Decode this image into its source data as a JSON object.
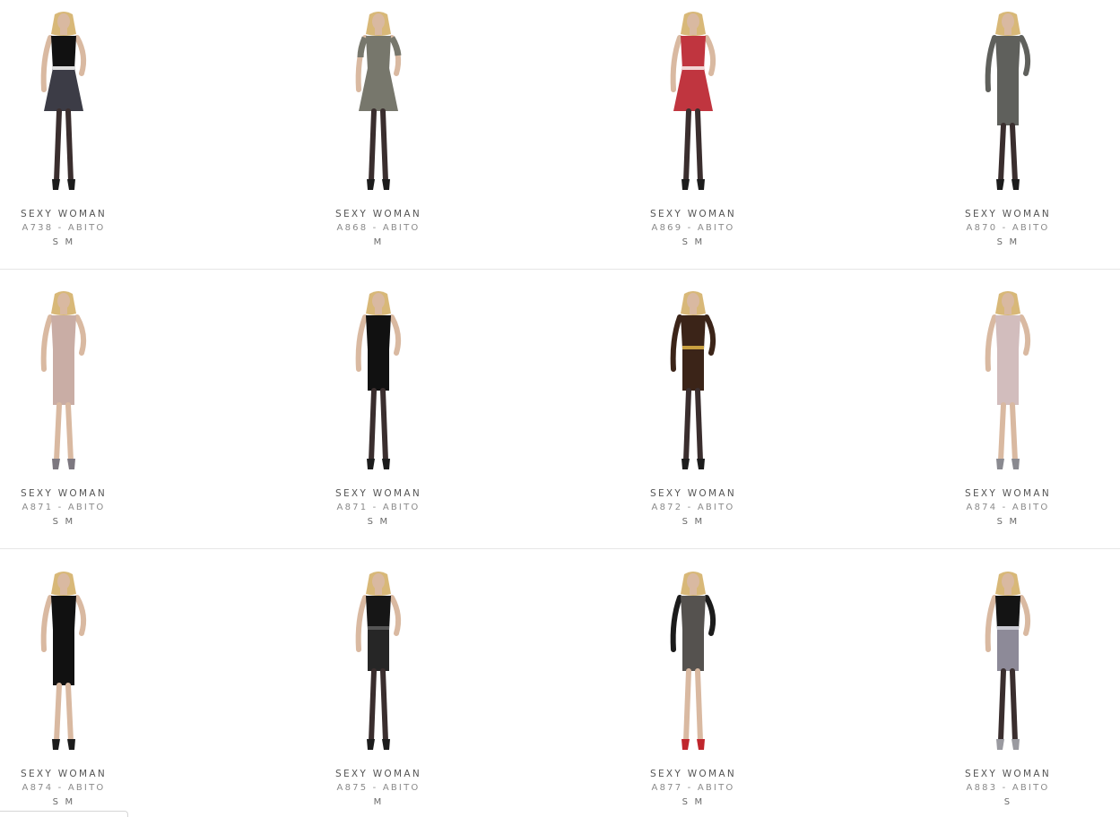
{
  "colors": {
    "skin": "#d9b9a1",
    "hair": "#d8b878",
    "hosiery": "#3a2e2e",
    "shoe": "#1c1c1c"
  },
  "products": [
    {
      "brand": "SEXY WOMAN",
      "model": "A738 - ABITO",
      "sizes": "S M",
      "top_color": "#111111",
      "skirt_color": "#3c3c46",
      "accent": "#dddddd",
      "sleeve": "none",
      "length": "short",
      "flare": "wide",
      "legs": "dark",
      "shoes": "#1c1c1c"
    },
    {
      "brand": "SEXY WOMAN",
      "model": "A868 - ABITO",
      "sizes": "M",
      "top_color": "#77776c",
      "skirt_color": "#77776c",
      "accent": "",
      "sleeve": "half",
      "length": "short",
      "flare": "wide",
      "legs": "dark",
      "shoes": "#1c1c1c"
    },
    {
      "brand": "SEXY WOMAN",
      "model": "A869 - ABITO",
      "sizes": "S M",
      "top_color": "#c0353f",
      "skirt_color": "#c0353f",
      "accent": "#f2d4d4",
      "sleeve": "none",
      "length": "short",
      "flare": "wide",
      "legs": "dark",
      "shoes": "#1c1c1c"
    },
    {
      "brand": "SEXY WOMAN",
      "model": "A870 - ABITO",
      "sizes": "S M",
      "top_color": "#5f605c",
      "skirt_color": "#5f605c",
      "accent": "",
      "sleeve": "long",
      "length": "knee",
      "flare": "narrow",
      "legs": "dark",
      "shoes": "#1c1c1c"
    },
    {
      "brand": "SEXY WOMAN",
      "model": "A871 - ABITO",
      "sizes": "S M",
      "top_color": "#c9ada5",
      "skirt_color": "#c9ada5",
      "accent": "",
      "sleeve": "none",
      "length": "knee",
      "flare": "narrow",
      "legs": "bare",
      "shoes": "#7d7880"
    },
    {
      "brand": "SEXY WOMAN",
      "model": "A871 - ABITO",
      "sizes": "S M",
      "top_color": "#111111",
      "skirt_color": "#111111",
      "accent": "",
      "sleeve": "none",
      "length": "short",
      "flare": "narrow",
      "legs": "dark",
      "shoes": "#1c1c1c"
    },
    {
      "brand": "SEXY WOMAN",
      "model": "A872 - ABITO",
      "sizes": "S M",
      "top_color": "#3b2418",
      "skirt_color": "#3b2418",
      "accent": "#c9a040",
      "sleeve": "long",
      "length": "short",
      "flare": "narrow",
      "legs": "dark",
      "shoes": "#1c1c1c"
    },
    {
      "brand": "SEXY WOMAN",
      "model": "A874 - ABITO",
      "sizes": "S M",
      "top_color": "#d2bdbd",
      "skirt_color": "#d2bdbd",
      "accent": "",
      "sleeve": "none",
      "length": "knee",
      "flare": "narrow",
      "legs": "bare",
      "shoes": "#8a8a90"
    },
    {
      "brand": "SEXY WOMAN",
      "model": "A874 - ABITO",
      "sizes": "S M",
      "top_color": "#111111",
      "skirt_color": "#111111",
      "accent": "",
      "sleeve": "none",
      "length": "knee",
      "flare": "narrow",
      "legs": "bare",
      "shoes": "#1c1c1c"
    },
    {
      "brand": "SEXY WOMAN",
      "model": "A875 - ABITO",
      "sizes": "M",
      "top_color": "#161616",
      "skirt_color": "#262626",
      "accent": "#555555",
      "sleeve": "none",
      "length": "short",
      "flare": "narrow",
      "legs": "dark",
      "shoes": "#1c1c1c"
    },
    {
      "brand": "SEXY WOMAN",
      "model": "A877 - ABITO",
      "sizes": "S M",
      "top_color": "#55524f",
      "skirt_color": "#55524f",
      "accent": "",
      "sleeve": "long-dark",
      "length": "short",
      "flare": "narrow",
      "legs": "bare",
      "shoes": "#c0262c"
    },
    {
      "brand": "SEXY WOMAN",
      "model": "A883 - ABITO",
      "sizes": "S",
      "top_color": "#141414",
      "skirt_color": "#8d8a98",
      "accent": "#c9c9d2",
      "sleeve": "none",
      "length": "short",
      "flare": "narrow",
      "legs": "dark",
      "shoes": "#9a9aa0"
    }
  ]
}
